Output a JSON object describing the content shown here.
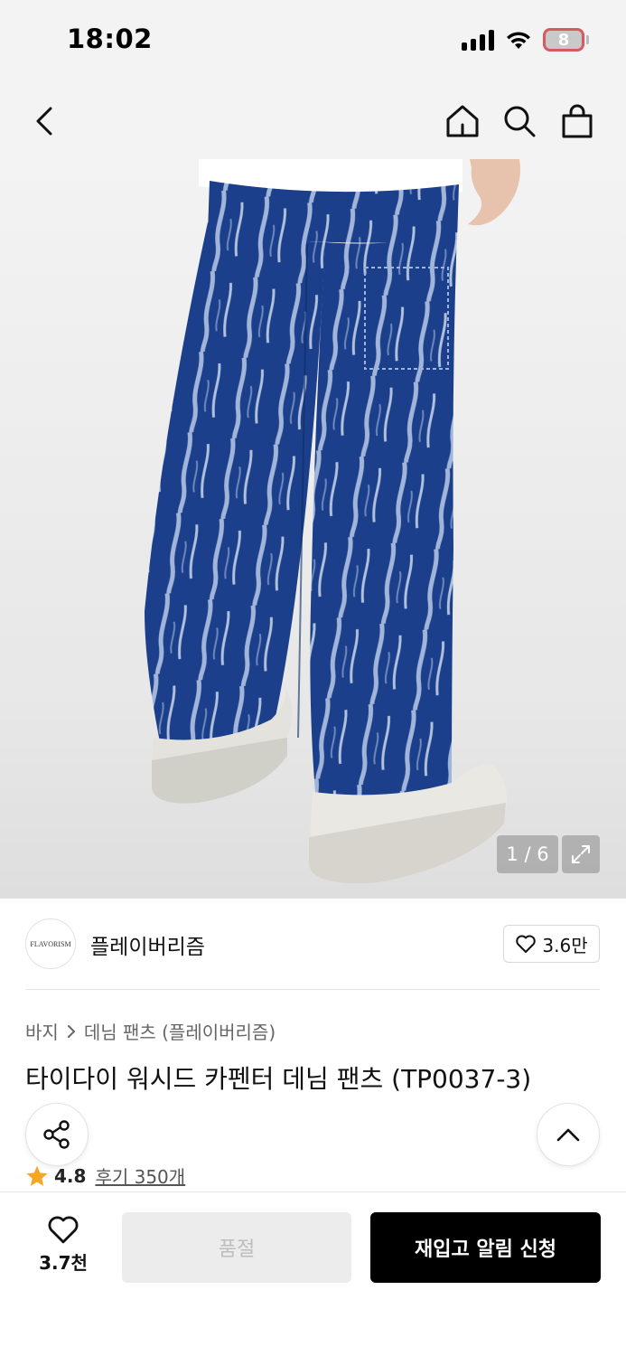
{
  "status_bar": {
    "time": "18:02",
    "battery_level": "8",
    "icons": [
      "signal-icon",
      "wifi-icon",
      "battery-icon"
    ]
  },
  "top_nav": {
    "icons": [
      "back-icon",
      "home-icon",
      "search-icon",
      "shopping-bag-icon"
    ]
  },
  "gallery": {
    "counter": "1 / 6",
    "icons": [
      "expand-icon"
    ]
  },
  "brand": {
    "logo_text": "FLAVORISM",
    "name": "플레이버리즘",
    "like_count": "3.6만"
  },
  "breadcrumb": {
    "category": "바지",
    "subcategory": "데님 팬츠 (플레이버리즘)"
  },
  "product": {
    "title": "타이다이 워시드 카펜터 데님 팬츠 (TP0037-3)",
    "rating": "4.8",
    "reviews": "후기 350개"
  },
  "bottom_bar": {
    "wish_count": "3.7천",
    "soldout_label": "품절",
    "restock_label": "재입고 알림 신청"
  },
  "colors": {
    "accent_black": "#000000",
    "star": "#f5a623",
    "battery_low": "#d9585e"
  }
}
